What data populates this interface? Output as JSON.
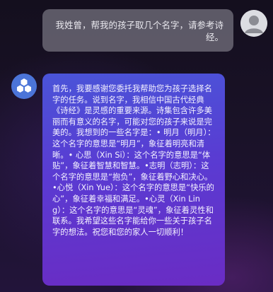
{
  "user_message": {
    "text": "我姓曾，帮我的孩子取几个名字，请参考诗经。"
  },
  "assistant_message": {
    "text": "首先，我要感谢您委托我帮助您为孩子选择名字的任务。说到名字，我相信中国古代经典《诗经》是灵感的重要来源。诗集包含许多美丽而有意义的名字，可能对您的孩子来说是完美的。我想到的一些名字是：• 明月（明月）：这个名字的意思是“明月”，象征着明亮和清晰。• 心思（Xin Si）：这个名字的意思是“体贴”，象征着智慧和智慧。•志明（志明）：这个名字的意思是“抱负”，象征着野心和决心。•心悦（Xin Yue）：这个名字的意思是“快乐的心”，象征着幸福和满足。•心灵（Xin Ling）：这个名字的意思是“灵魂”，象征着灵性和联系。我希望这些名字能给你一些关于孩子名字的想法。祝您和您的家人一切顺利！"
  },
  "icons": {
    "user_avatar": "user-silhouette-icon",
    "bot_avatar": "hexagon-cluster-icon"
  },
  "colors": {
    "bot_bubble_start": "#4a54d8",
    "bot_bubble_end": "#6a2cc4",
    "user_bubble": "#787682"
  }
}
